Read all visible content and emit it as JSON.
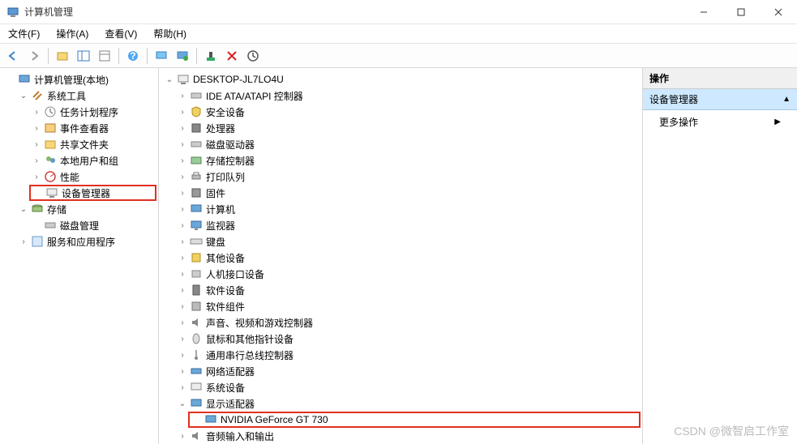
{
  "window": {
    "title": "计算机管理"
  },
  "menu": {
    "file": "文件(F)",
    "action": "操作(A)",
    "view": "查看(V)",
    "help": "帮助(H)"
  },
  "left_tree": {
    "root": "计算机管理(本地)",
    "sys_tools": "系统工具",
    "task_scheduler": "任务计划程序",
    "event_viewer": "事件查看器",
    "shared_folders": "共享文件夹",
    "local_users": "本地用户和组",
    "performance": "性能",
    "device_manager": "设备管理器",
    "storage": "存储",
    "disk_mgmt": "磁盘管理",
    "services_apps": "服务和应用程序"
  },
  "mid_tree": {
    "root": "DESKTOP-JL7LO4U",
    "items": [
      "IDE ATA/ATAPI 控制器",
      "安全设备",
      "处理器",
      "磁盘驱动器",
      "存储控制器",
      "打印队列",
      "固件",
      "计算机",
      "监视器",
      "键盘",
      "其他设备",
      "人机接口设备",
      "软件设备",
      "软件组件",
      "声音、视频和游戏控制器",
      "鼠标和其他指针设备",
      "通用串行总线控制器",
      "网络适配器",
      "系统设备"
    ],
    "display_adapters": "显示适配器",
    "gpu": "NVIDIA GeForce GT 730",
    "audio_io": "音频输入和输出"
  },
  "right_panel": {
    "header": "操作",
    "section": "设备管理器",
    "more": "更多操作"
  },
  "watermark": "CSDN @微智启工作室"
}
